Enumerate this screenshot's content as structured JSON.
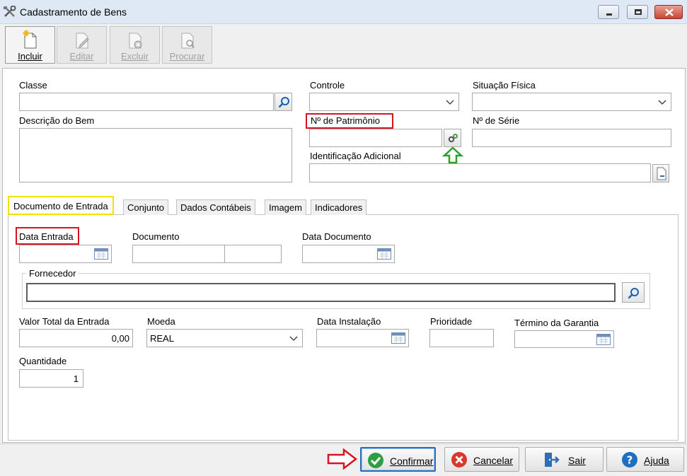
{
  "window": {
    "title": "Cadastramento de Bens"
  },
  "toolbar": {
    "incluir": "Incluir",
    "editar": "Editar",
    "excluir": "Excluir",
    "procurar": "Procurar"
  },
  "form": {
    "classe_label": "Classe",
    "classe_value": "",
    "controle_label": "Controle",
    "controle_value": "",
    "situacao_label": "Situação Física",
    "situacao_value": "",
    "descricao_label": "Descrição do Bem",
    "descricao_value": "",
    "patrimonio_label": "Nº de Patrimônio",
    "patrimonio_value": "",
    "serie_label": "Nº de Série",
    "serie_value": "",
    "identificacao_label": "Identificação Adicional",
    "identificacao_value": ""
  },
  "tabs": [
    {
      "label": "Documento de Entrada",
      "active": true
    },
    {
      "label": "Conjunto"
    },
    {
      "label": "Dados Contábeis"
    },
    {
      "label": "Imagem"
    },
    {
      "label": "Indicadores"
    }
  ],
  "entrada": {
    "data_entrada_label": "Data Entrada",
    "data_entrada_value": "",
    "documento_label": "Documento",
    "documento_value_1": "",
    "documento_value_2": "",
    "data_documento_label": "Data Documento",
    "data_documento_value": "",
    "fornecedor_label": "Fornecedor",
    "fornecedor_value": "",
    "valor_total_label": "Valor Total da Entrada",
    "valor_total_value": "0,00",
    "moeda_label": "Moeda",
    "moeda_value": "REAL",
    "data_instalacao_label": "Data Instalação",
    "data_instalacao_value": "",
    "prioridade_label": "Prioridade",
    "prioridade_value": "",
    "termino_label": "Término da Garantia",
    "termino_value": "",
    "quantidade_label": "Quantidade",
    "quantidade_value": "1"
  },
  "buttons": {
    "confirmar": "Confirmar",
    "cancelar": "Cancelar",
    "sair": "Sair",
    "ajuda": "Ajuda"
  },
  "colors": {
    "highlight_red": "#d9141e",
    "highlight_yellow": "#f2e200",
    "arrow_green": "#2ca02c",
    "focus_blue": "#2a6fb8"
  }
}
